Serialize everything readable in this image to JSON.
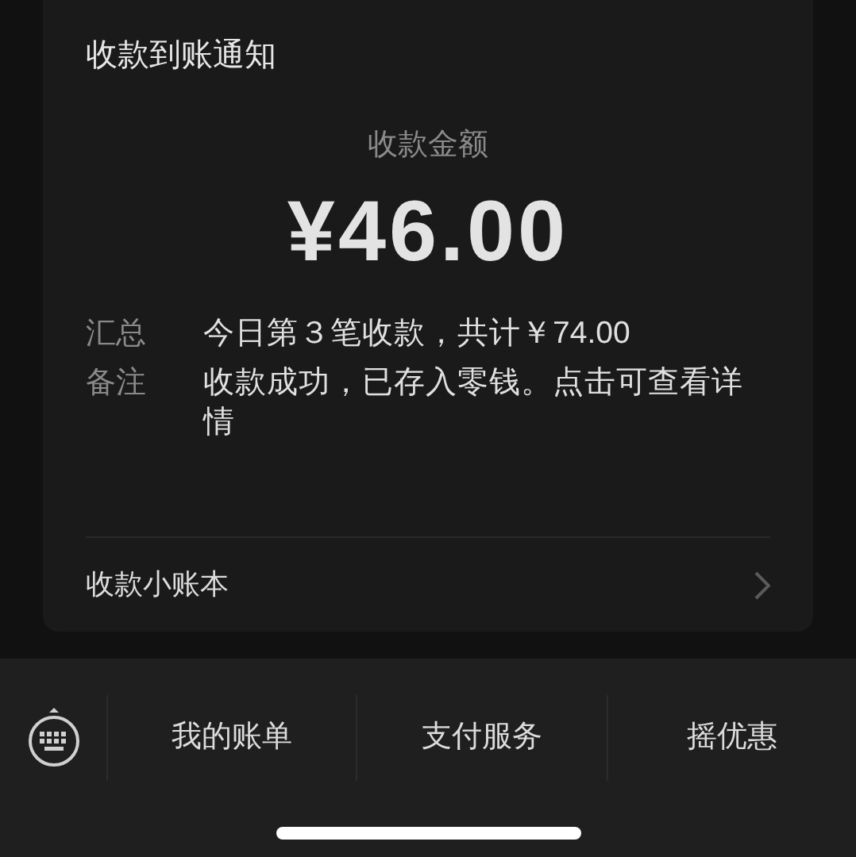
{
  "card": {
    "title": "收款到账通知",
    "amount_label": "收款金额",
    "amount": "¥46.00",
    "fields": [
      {
        "label": "汇总",
        "value": "今日第３笔收款，共计￥74.00"
      },
      {
        "label": "备注",
        "value": "收款成功，已存入零钱。点击可查看详情"
      }
    ],
    "link": "收款小账本"
  },
  "menu": {
    "items": [
      "我的账单",
      "支付服务",
      "摇优惠"
    ]
  }
}
